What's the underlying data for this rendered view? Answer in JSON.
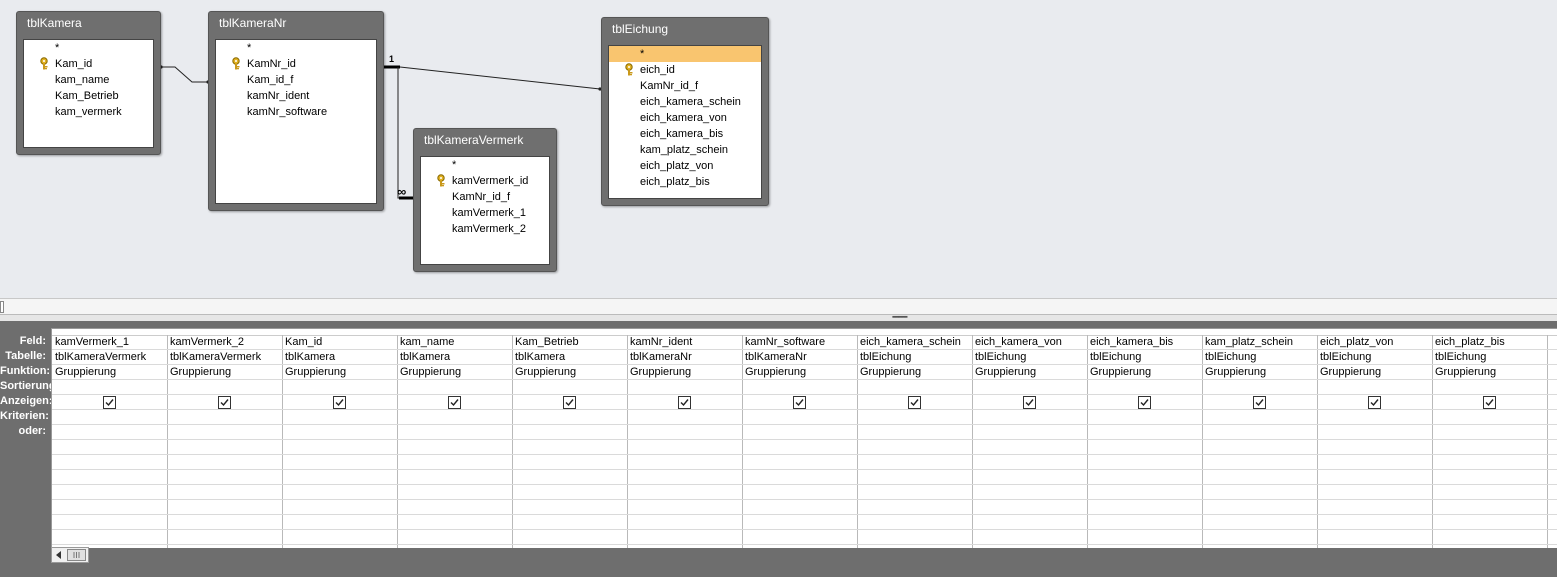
{
  "tables": [
    {
      "id": "tblKamera",
      "title": "tblKamera",
      "fields": [
        "*",
        "Kam_id",
        "kam_name",
        "Kam_Betrieb",
        "kam_vermerk"
      ],
      "key_index": 1,
      "selected_index": -1
    },
    {
      "id": "tblKameraNr",
      "title": "tblKameraNr",
      "fields": [
        "*",
        "KamNr_id",
        "Kam_id_f",
        "kamNr_ident",
        "kamNr_software"
      ],
      "key_index": 1,
      "selected_index": -1
    },
    {
      "id": "tblKameraVermerk",
      "title": "tblKameraVermerk",
      "fields": [
        "*",
        "kamVermerk_id",
        "KamNr_id_f",
        "kamVermerk_1",
        "kamVermerk_2"
      ],
      "key_index": 1,
      "selected_index": -1
    },
    {
      "id": "tblEichung",
      "title": "tblEichung",
      "fields": [
        "*",
        "eich_id",
        "KamNr_id_f",
        "eich_kamera_schein",
        "eich_kamera_von",
        "eich_kamera_bis",
        "kam_platz_schein",
        "eich_platz_von",
        "eich_platz_bis"
      ],
      "key_index": 1,
      "selected_index": 0
    }
  ],
  "relations": {
    "one_label": "1",
    "many_label": "∞"
  },
  "grid": {
    "row_labels": [
      "Feld:",
      "Tabelle:",
      "Funktion:",
      "Sortierung:",
      "Anzeigen:",
      "Kriterien:",
      "oder:"
    ],
    "columns": [
      {
        "field": "kamVermerk_1",
        "table": "tblKameraVermerk",
        "function": "Gruppierung",
        "show": true
      },
      {
        "field": "kamVermerk_2",
        "table": "tblKameraVermerk",
        "function": "Gruppierung",
        "show": true
      },
      {
        "field": "Kam_id",
        "table": "tblKamera",
        "function": "Gruppierung",
        "show": true
      },
      {
        "field": "kam_name",
        "table": "tblKamera",
        "function": "Gruppierung",
        "show": true
      },
      {
        "field": "Kam_Betrieb",
        "table": "tblKamera",
        "function": "Gruppierung",
        "show": true
      },
      {
        "field": "kamNr_ident",
        "table": "tblKameraNr",
        "function": "Gruppierung",
        "show": true
      },
      {
        "field": "kamNr_software",
        "table": "tblKameraNr",
        "function": "Gruppierung",
        "show": true
      },
      {
        "field": "eich_kamera_schein",
        "table": "tblEichung",
        "function": "Gruppierung",
        "show": true
      },
      {
        "field": "eich_kamera_von",
        "table": "tblEichung",
        "function": "Gruppierung",
        "show": true
      },
      {
        "field": "eich_kamera_bis",
        "table": "tblEichung",
        "function": "Gruppierung",
        "show": true
      },
      {
        "field": "kam_platz_schein",
        "table": "tblEichung",
        "function": "Gruppierung",
        "show": true
      },
      {
        "field": "eich_platz_von",
        "table": "tblEichung",
        "function": "Gruppierung",
        "show": true
      },
      {
        "field": "eich_platz_bis",
        "table": "tblEichung",
        "function": "Gruppierung",
        "show": true
      },
      {
        "field": "",
        "table": "",
        "function": "",
        "show": false
      }
    ]
  },
  "colors": {
    "selected_field": "#f9c56f",
    "table_frame": "#6f6f6f",
    "diagram_background": "#e9ebef",
    "grid_background": "#6e6e6e"
  }
}
